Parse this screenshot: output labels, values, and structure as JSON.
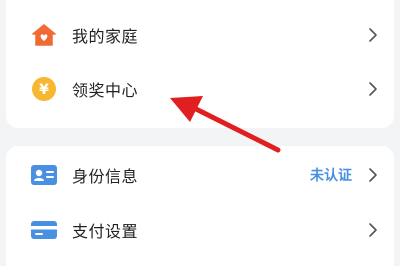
{
  "menu_group_1": {
    "items": [
      {
        "label": "我的家庭",
        "icon": "home-icon"
      },
      {
        "label": "领奖中心",
        "icon": "yuan-coin-icon"
      }
    ]
  },
  "menu_group_2": {
    "items": [
      {
        "label": "身份信息",
        "icon": "id-card-icon",
        "status": "未认证"
      },
      {
        "label": "支付设置",
        "icon": "credit-card-icon"
      }
    ]
  },
  "colors": {
    "home_icon": "#f06a35",
    "coin_icon": "#f7b731",
    "card_icon": "#4a90e2",
    "status_text": "#4a90e2",
    "annotation_arrow": "#e02020"
  },
  "coin_symbol": "¥"
}
